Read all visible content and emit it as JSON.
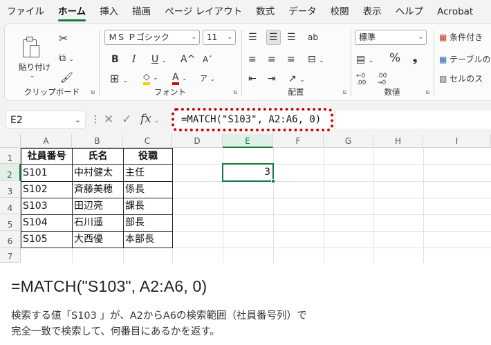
{
  "menu": {
    "tabs": [
      "ファイル",
      "ホーム",
      "挿入",
      "描画",
      "ページ レイアウト",
      "数式",
      "データ",
      "校閲",
      "表示",
      "ヘルプ",
      "Acrobat"
    ],
    "active": "ホーム"
  },
  "ribbon": {
    "clipboard": {
      "paste_label": "貼り付け",
      "group_label": "クリップボード"
    },
    "font": {
      "font_name": "ＭＳ Ｐゴシック",
      "font_size": "11",
      "bold": "B",
      "italic": "I",
      "underline": "U",
      "grow": "A^",
      "shrink": "Aˇ",
      "font_color_glyph": "A",
      "phonetic_glyph": "ア",
      "group_label": "フォント"
    },
    "alignment": {
      "group_label": "配置",
      "wrap_glyph": "ab"
    },
    "number": {
      "format": "標準",
      "percent": "%",
      "comma": "❟",
      "inc_decimal": "←0 .00",
      "dec_decimal": ".00 →0",
      "group_label": "数値"
    },
    "styles": {
      "conditional": "条件付き",
      "table": "テーブルの",
      "cell_styles": "セルのス"
    }
  },
  "formula_bar": {
    "name_box": "E2",
    "formula": "=MATCH(\"S103\", A2:A6, 0)"
  },
  "sheet": {
    "columns": [
      "A",
      "B",
      "C",
      "D",
      "E",
      "F",
      "G",
      "H",
      "I"
    ],
    "rows": [
      "1",
      "2",
      "3",
      "4",
      "5",
      "6",
      "7"
    ],
    "selected_column": "E",
    "selected_row": "2",
    "header": [
      "社員番号",
      "氏名",
      "役職"
    ],
    "data": [
      [
        "S101",
        "中村健太",
        "主任"
      ],
      [
        "S102",
        "斉藤美穂",
        "係長"
      ],
      [
        "S103",
        "田辺亮",
        "課長"
      ],
      [
        "S104",
        "石川遥",
        "部長"
      ],
      [
        "S105",
        "大西優",
        "本部長"
      ]
    ],
    "e2_value": "3"
  },
  "caption": {
    "formula": "=MATCH(\"S103\", A2:A6, 0)",
    "line1": "検索する値「S103 」が、A2からA6の検索範囲（社員番号列）で",
    "line2": "完全一致で検索して、何番目にあるかを返す。"
  },
  "colors": {
    "accent_green": "#117a41",
    "highlight_red": "#d40000",
    "font_color_bar": "#e00000",
    "fill_color_bar": "#f2d200"
  }
}
